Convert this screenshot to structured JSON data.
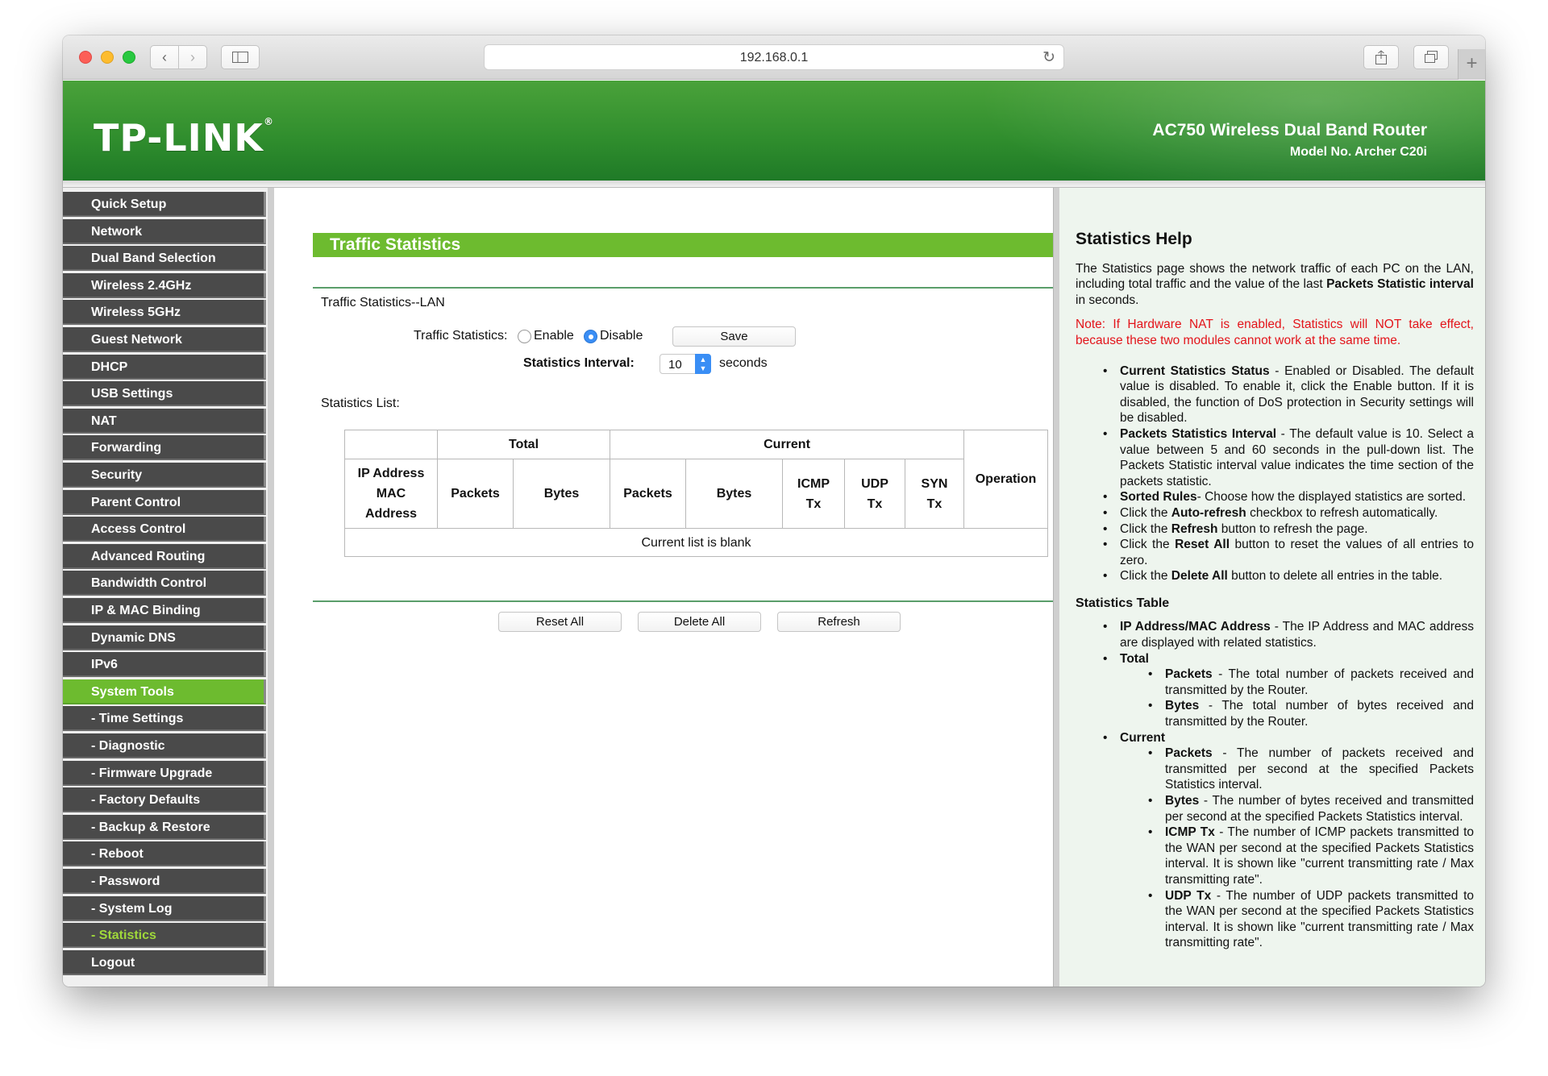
{
  "browser": {
    "address": "192.168.0.1"
  },
  "header": {
    "logo": "TP-LINK",
    "logo_mark": "®",
    "product": "AC750 Wireless Dual Band Router",
    "model": "Model No. Archer C20i"
  },
  "sidebar": {
    "items": [
      "Quick Setup",
      "Network",
      "Dual Band Selection",
      "Wireless 2.4GHz",
      "Wireless 5GHz",
      "Guest Network",
      "DHCP",
      "USB Settings",
      "NAT",
      "Forwarding",
      "Security",
      "Parent Control",
      "Access Control",
      "Advanced Routing",
      "Bandwidth Control",
      "IP & MAC Binding",
      "Dynamic DNS",
      "IPv6",
      "System Tools",
      "- Time Settings",
      "- Diagnostic",
      "- Firmware Upgrade",
      "- Factory Defaults",
      "- Backup & Restore",
      "- Reboot",
      "- Password",
      "- System Log",
      "- Statistics",
      "Logout"
    ],
    "active_item": "System Tools",
    "current_item": "- Statistics"
  },
  "main": {
    "title": "Traffic Statistics",
    "subtitle": "Traffic Statistics--LAN",
    "traffic_label": "Traffic Statistics:",
    "enable_label": "Enable",
    "disable_label": "Disable",
    "selected_option": "Disable",
    "save_label": "Save",
    "interval_label": "Statistics Interval:",
    "interval_value": "10",
    "interval_unit": "seconds",
    "list_label": "Statistics List:",
    "table": {
      "total": "Total",
      "current": "Current",
      "ip_mac_line1": "IP Address",
      "ip_mac_line2": "MAC",
      "ip_mac_line3": "Address",
      "packets": "Packets",
      "bytes": "Bytes",
      "icmp_line1": "ICMP",
      "icmp_line2": "Tx",
      "udp_line1": "UDP",
      "udp_line2": "Tx",
      "syn_line1": "SYN",
      "syn_line2": "Tx",
      "operation": "Operation",
      "empty": "Current list is blank"
    },
    "reset_all": "Reset All",
    "delete_all": "Delete All",
    "refresh": "Refresh"
  },
  "help": {
    "title": "Statistics Help",
    "intro_a": "The Statistics page shows the network traffic of each PC on the LAN, including total traffic and the value of the last ",
    "intro_b": "Packets Statistic interval",
    "intro_c": " in seconds.",
    "note": "Note: If Hardware NAT is enabled, Statistics will NOT take effect, because these two modules cannot work at the same time.",
    "i1_b": "Current Statistics Status",
    "i1_t": " - Enabled or Disabled. The default value is disabled. To enable it, click the Enable button. If it is disabled, the function of DoS protection in Security settings will be disabled.",
    "i2_b": "Packets Statistics Interval",
    "i2_t": " - The default value is 10. Select a value between 5 and 60 seconds in the pull-down list. The Packets Statistic interval value indicates the time section of the packets statistic.",
    "i3_b": "Sorted Rules",
    "i3_t": "- Choose how the displayed statistics are sorted.",
    "i4_a": "Click the ",
    "i4_b": "Auto-refresh",
    "i4_c": " checkbox to refresh automatically.",
    "i5_a": "Click the ",
    "i5_b": "Refresh",
    "i5_c": " button to refresh the page.",
    "i6_a": "Click the ",
    "i6_b": "Reset All",
    "i6_c": " button to reset the values of all entries to zero.",
    "i7_a": "Click the ",
    "i7_b": "Delete All",
    "i7_c": " button to delete all entries in the table.",
    "table_title": "Statistics Table",
    "t1_b": "IP Address/MAC Address",
    "t1_t": " - The IP Address and MAC address are displayed with related statistics.",
    "t2_b": "Total",
    "t2_1b": "Packets",
    "t2_1t": " - The total number of packets received and transmitted by the Router.",
    "t2_2b": "Bytes",
    "t2_2t": " - The total number of bytes received and transmitted by the Router.",
    "t3_b": "Current",
    "t3_1b": "Packets",
    "t3_1t": " - The number of packets received and transmitted per second at the specified Packets Statistics interval.",
    "t3_2b": "Bytes",
    "t3_2t": " - The number of bytes received and transmitted per second at the specified Packets Statistics interval.",
    "t3_3b": "ICMP Tx",
    "t3_3t": " - The number of ICMP packets transmitted to the WAN per second at the specified Packets Statistics interval. It is shown like \"current transmitting rate / Max transmitting rate\".",
    "t3_4b": "UDP Tx",
    "t3_4t": " - The number of UDP packets transmitted to the WAN per second at the specified Packets Statistics interval. It is shown like \"current transmitting rate / Max transmitting rate\"."
  }
}
